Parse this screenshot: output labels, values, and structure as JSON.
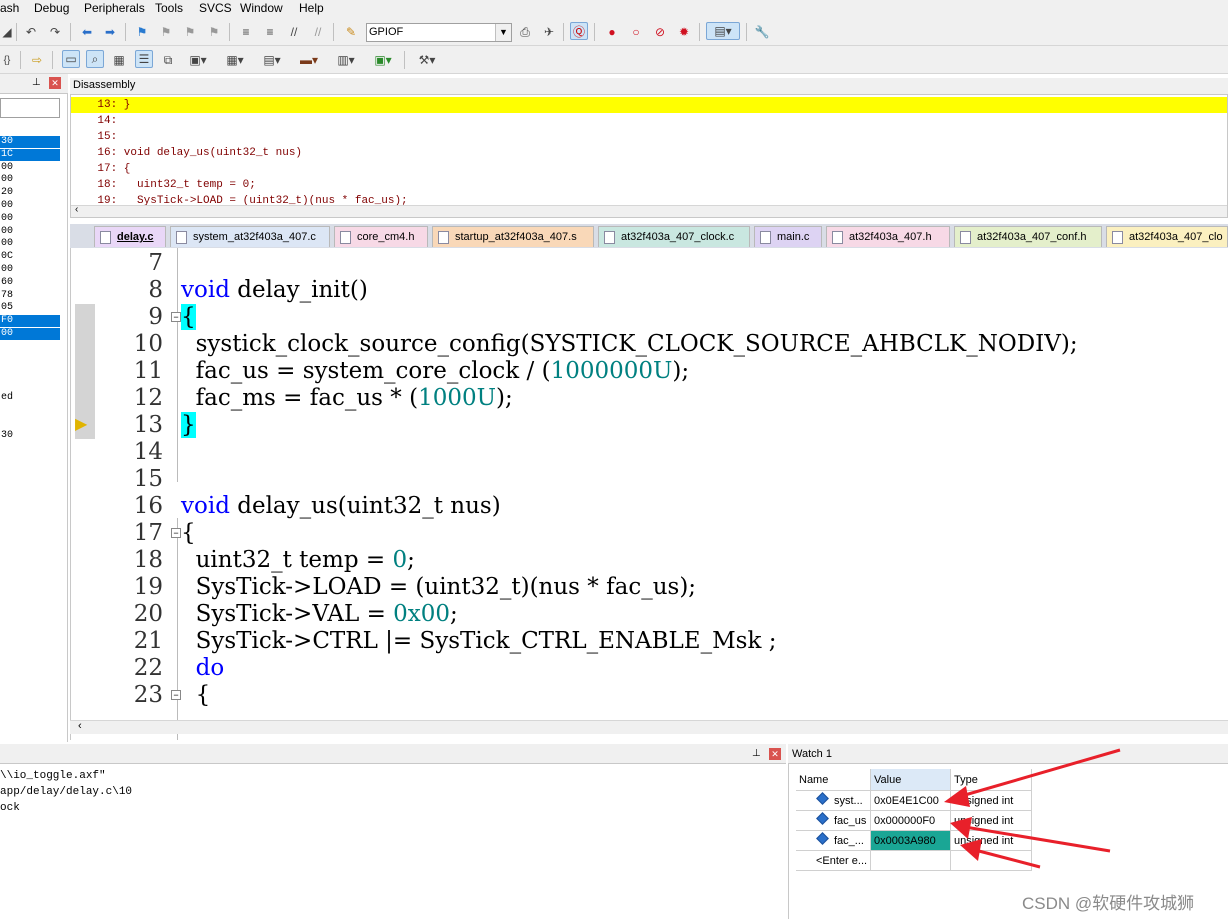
{
  "menu": [
    "ash",
    "Debug",
    "Peripherals",
    "Tools",
    "SVCS",
    "Window",
    "Help"
  ],
  "toolbar": {
    "target": "GPIOF",
    "brace_icon_text": "{}"
  },
  "left_panel": {
    "rows": [
      "30",
      "1C",
      "00",
      "00",
      "20",
      "00",
      "00",
      "00",
      "00",
      "0C",
      "00",
      "60",
      "78",
      "05",
      "F0",
      "00",
      "",
      "",
      "",
      "",
      "ed",
      "",
      "",
      "30"
    ]
  },
  "disassembly": {
    "title": "Disassembly",
    "lines": [
      "    13: }",
      "    14:",
      "    15:",
      "    16: void delay_us(uint32_t nus)",
      "    17: {",
      "    18:   uint32_t temp = 0;",
      "    19:   SysTick->LOAD = (uint32_t)(nus * fac_us);"
    ]
  },
  "tabs": [
    {
      "label": "delay.c",
      "color": "#e9d7f7"
    },
    {
      "label": "system_at32f403a_407.c",
      "color": "#dce6f5"
    },
    {
      "label": "core_cm4.h",
      "color": "#f7d9e6"
    },
    {
      "label": "startup_at32f403a_407.s",
      "color": "#f9d8b8"
    },
    {
      "label": "at32f403a_407_clock.c",
      "color": "#c9e7e0"
    },
    {
      "label": "main.c",
      "color": "#ddd3f3"
    },
    {
      "label": "at32f403a_407.h",
      "color": "#f7d9e6"
    },
    {
      "label": "at32f403a_407_conf.h",
      "color": "#e4efcb"
    },
    {
      "label": "at32f403a_407_clo",
      "color": "#fbf0c0"
    }
  ],
  "code": {
    "lines": [
      {
        "n": "7",
        "t": ""
      },
      {
        "n": "8",
        "t": "void delay_init()"
      },
      {
        "n": "9",
        "t": "{"
      },
      {
        "n": "10",
        "t": "  systick_clock_source_config(SYSTICK_CLOCK_SOURCE_AHBCLK_NODIV);"
      },
      {
        "n": "11",
        "t": "  fac_us = system_core_clock / (1000000U);"
      },
      {
        "n": "12",
        "t": "  fac_ms = fac_us * (1000U);"
      },
      {
        "n": "13",
        "t": "}"
      },
      {
        "n": "14",
        "t": ""
      },
      {
        "n": "15",
        "t": ""
      },
      {
        "n": "16",
        "t": "void delay_us(uint32_t nus)"
      },
      {
        "n": "17",
        "t": "{"
      },
      {
        "n": "18",
        "t": "  uint32_t temp = 0;"
      },
      {
        "n": "19",
        "t": "  SysTick->LOAD = (uint32_t)(nus * fac_us);"
      },
      {
        "n": "20",
        "t": "  SysTick->VAL = 0x00;"
      },
      {
        "n": "21",
        "t": "  SysTick->CTRL |= SysTick_CTRL_ENABLE_Msk ;"
      },
      {
        "n": "22",
        "t": "  do"
      },
      {
        "n": "23",
        "t": "  {"
      }
    ]
  },
  "command": {
    "lines": [
      "\\\\io_toggle.axf\"",
      "app/delay/delay.c\\10",
      "ock"
    ]
  },
  "watch": {
    "title": "Watch 1",
    "headers": {
      "name": "Name",
      "value": "Value",
      "type": "Type"
    },
    "rows": [
      {
        "name": "syst...",
        "value": "0x0E4E1C00",
        "type": "unsigned int"
      },
      {
        "name": "fac_us",
        "value": "0x000000F0",
        "type": "unsigned int"
      },
      {
        "name": "fac_...",
        "value": "0x0003A980",
        "type": "unsigned int"
      },
      {
        "name": "<Enter e...",
        "value": "",
        "type": ""
      }
    ]
  },
  "watermark": "CSDN @软硬件攻城狮",
  "colors": {
    "highlight_yellow": "#ffff00",
    "selection_blue": "#0078d7",
    "arrow_red": "#e8202a",
    "watch_value_selected": "#1aa695"
  }
}
